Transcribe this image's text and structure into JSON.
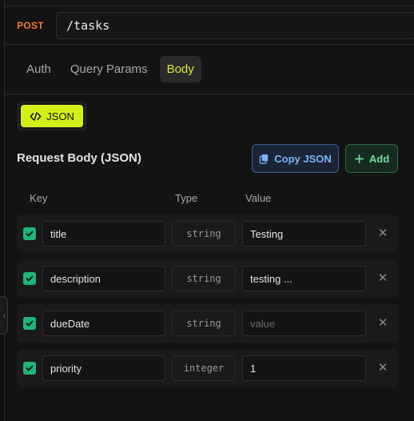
{
  "request": {
    "method": "POST",
    "url": "/tasks"
  },
  "tabs": [
    {
      "label": "Auth",
      "active": false
    },
    {
      "label": "Query Params",
      "active": false
    },
    {
      "label": "Body",
      "active": true
    }
  ],
  "body_format": {
    "label": "JSON",
    "icon": "code-icon"
  },
  "section": {
    "title": "Request Body (JSON)",
    "copy_label": "Copy JSON",
    "add_label": "Add"
  },
  "columns": {
    "key": "Key",
    "type": "Type",
    "value": "Value"
  },
  "rows": [
    {
      "enabled": true,
      "key": "title",
      "type": "string",
      "value": "Testing",
      "placeholder": ""
    },
    {
      "enabled": true,
      "key": "description",
      "type": "string",
      "value": "testing ...",
      "placeholder": ""
    },
    {
      "enabled": true,
      "key": "dueDate",
      "type": "string",
      "value": "",
      "placeholder": "value"
    },
    {
      "enabled": true,
      "key": "priority",
      "type": "integer",
      "value": "1",
      "placeholder": ""
    }
  ],
  "colors": {
    "method": "#f07a3a",
    "accent": "#d4ee1a",
    "copy": "#7fb1ff",
    "add": "#6fdf9b",
    "checkbox": "#22b57a"
  }
}
